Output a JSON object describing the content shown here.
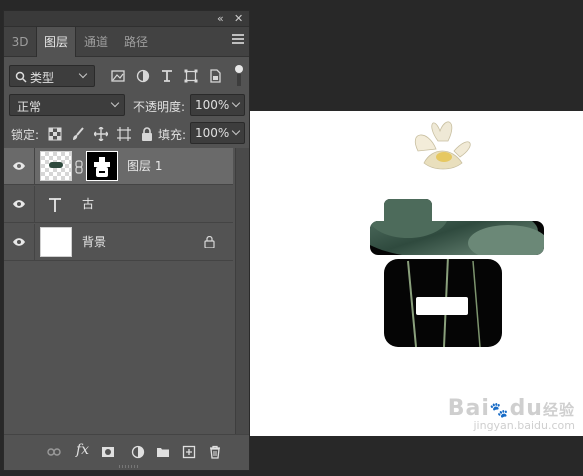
{
  "panel": {
    "collapse_icon": "double-chevron-left-icon",
    "close_icon": "close-icon",
    "tabs": [
      {
        "label": "3D",
        "active": false
      },
      {
        "label": "图层",
        "active": true
      },
      {
        "label": "通道",
        "active": false
      },
      {
        "label": "路径",
        "active": false
      }
    ],
    "menu_icon": "hamburger-menu-icon"
  },
  "filter": {
    "kind_label": "类型",
    "kind_icon": "search-icon",
    "filter_icons": [
      "pixel-filter-icon",
      "adjustment-filter-icon",
      "type-filter-icon",
      "shape-filter-icon",
      "smart-object-filter-icon"
    ]
  },
  "blend": {
    "mode": "正常",
    "opacity_label": "不透明度:",
    "opacity_value": "100%"
  },
  "lock": {
    "label": "锁定:",
    "icons": [
      "lock-transparent-icon",
      "lock-paint-icon",
      "lock-move-icon",
      "lock-artboard-icon",
      "lock-all-icon"
    ],
    "fill_label": "填充:",
    "fill_value": "100%"
  },
  "layers": [
    {
      "name": "图层 1",
      "type": "pixel-with-mask",
      "visible": true,
      "selected": true
    },
    {
      "name": "古",
      "type": "text",
      "visible": true,
      "selected": false
    },
    {
      "name": "背景",
      "type": "background",
      "visible": true,
      "selected": false,
      "locked": true
    }
  ],
  "bottom_icons": [
    "link-layers-icon",
    "fx-icon",
    "add-mask-icon",
    "adjustment-layer-icon",
    "group-folder-icon",
    "new-layer-icon",
    "trash-icon"
  ],
  "watermark": {
    "logo_text": "Bai",
    "logo_mid": "du",
    "logo_suffix": "经验",
    "url": "jingyan.baidu.com"
  },
  "colors": {
    "panel_bg": "#535353",
    "canvas_bg": "#282828",
    "selected_layer": "#6a6a6a"
  }
}
